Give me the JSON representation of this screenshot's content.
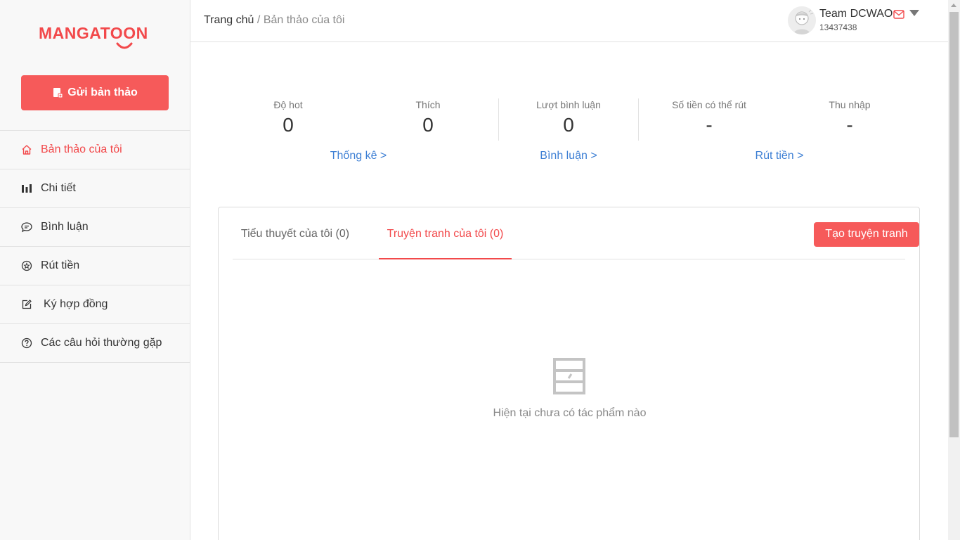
{
  "brand": {
    "logo_text": "MANGATOON",
    "accent_color": "#f2494b",
    "button_color": "#f65a5a",
    "link_color": "#3d7fd4"
  },
  "sidebar": {
    "submit_button_label": "Gửi bản thảo",
    "items": [
      {
        "label": "Bản thảo của tôi",
        "icon": "home-icon",
        "active": true
      },
      {
        "label": "Chi tiết",
        "icon": "bar-chart-icon",
        "active": false
      },
      {
        "label": "Bình luận",
        "icon": "comment-icon",
        "active": false
      },
      {
        "label": "Rút tiền",
        "icon": "coin-icon",
        "active": false
      },
      {
        "label": "Ký hợp đồng",
        "icon": "edit-icon",
        "active": false
      },
      {
        "label": "Các câu hỏi thường gặp",
        "icon": "question-icon",
        "active": false
      }
    ]
  },
  "header": {
    "breadcrumb": {
      "home": "Trang chủ",
      "separator": "/",
      "current": "Bản thảo của tôi"
    },
    "user": {
      "name": "Team DCWAO",
      "id": "13437438"
    }
  },
  "stats": [
    {
      "label": "Độ hot",
      "value": "0"
    },
    {
      "label": "Thích",
      "value": "0"
    },
    {
      "label": "Lượt bình luận",
      "value": "0"
    },
    {
      "label": "Số tiền có thể rút",
      "value": "-"
    },
    {
      "label": "Thu nhập",
      "value": "-"
    }
  ],
  "links": {
    "stats": "Thống kê >",
    "comments": "Bình luận >",
    "withdraw": "Rút tiền >"
  },
  "works": {
    "tabs": [
      {
        "label": "Tiểu thuyết của tôi (0)",
        "active": false
      },
      {
        "label": "Truyện tranh của tôi (0)",
        "active": true
      }
    ],
    "create_button": "Tạo truyện tranh",
    "empty_text": "Hiện tại chưa có tác phẩm nào"
  }
}
